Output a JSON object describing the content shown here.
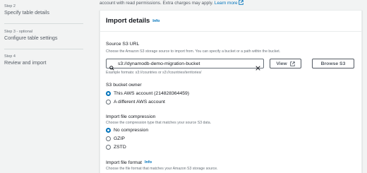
{
  "wizard": {
    "steps": [
      {
        "num": "Step 2",
        "title": "Specify table details"
      },
      {
        "num": "Step 3 - optional",
        "title": "Configure table settings"
      },
      {
        "num": "Step 4",
        "title": "Review and import"
      }
    ]
  },
  "top_description": {
    "text": "account with read permissions. Extra charges may apply.",
    "link": "Learn more"
  },
  "import_details": {
    "title": "Import details",
    "info": "Info",
    "s3_url": {
      "label": "Source S3 URL",
      "description": "Choose the Amazon S3 storage source to import from. You can specify a bucket or a path within the bucket.",
      "value": "s3://dynamodb-demo-migration-bucket",
      "example": "Example formats: s3://countries or s3://countries/territories/",
      "view_button": "View",
      "browse_button": "Browse S3"
    },
    "bucket_owner": {
      "label": "S3 bucket owner",
      "options": [
        {
          "label": "This AWS account (214828364459)",
          "checked": true
        },
        {
          "label": "A different AWS account",
          "checked": false
        }
      ]
    },
    "compression": {
      "label": "Import file compression",
      "description": "Choose the compression type that matches your source S3 data.",
      "options": [
        {
          "label": "No compression",
          "checked": true
        },
        {
          "label": "GZIP",
          "checked": false
        },
        {
          "label": "ZSTD",
          "checked": false
        }
      ]
    },
    "file_format": {
      "label": "Import file format",
      "info": "Info",
      "description": "Choose the file format that matches your Amazon S3 storage source."
    }
  },
  "colors": {
    "accent": "#0073bb",
    "background": "#f2f3f3",
    "panel": "#ffffff"
  }
}
